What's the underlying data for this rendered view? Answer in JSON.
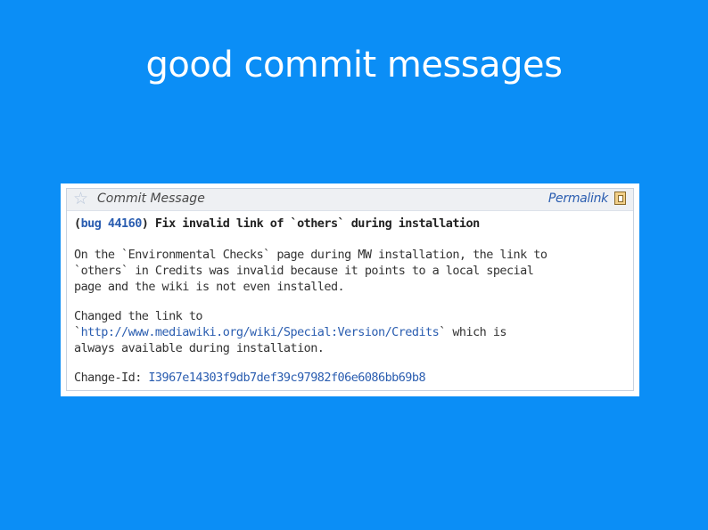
{
  "slide": {
    "title": "good commit messages"
  },
  "panel": {
    "header_title": "Commit Message",
    "permalink_label": "Permalink"
  },
  "commit": {
    "subject_open": "(",
    "bug_link": "bug 44160",
    "subject_rest": ") Fix invalid link of `others` during installation",
    "body_line_1": "On the `Environmental Checks` page during MW installation, the link to",
    "body_line_2": "`others` in Credits was invalid because it points to a local special",
    "body_line_3": "page and the wiki is not even installed.",
    "changed_line_1": "Changed the link to",
    "changed_link_prefix": "`",
    "changed_link_url": "http://www.mediawiki.org/wiki/Special:Version/Credits",
    "changed_link_suffix": "` which is",
    "changed_line_3": "always available during installation.",
    "change_id_label": "Change-Id: ",
    "change_id_value": "I3967e14303f9db7def39c97982f06e6086bb69b8"
  },
  "colors": {
    "background": "#0b8ef6",
    "link": "#2a5db0"
  },
  "icons": {
    "star": "star-icon",
    "copy": "copy-permalink-icon"
  }
}
